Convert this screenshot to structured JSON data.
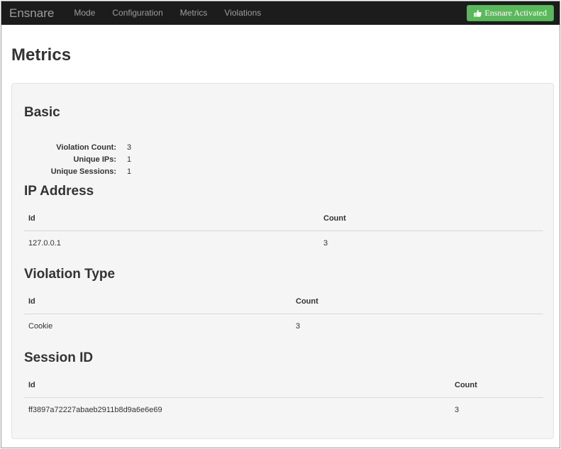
{
  "navbar": {
    "brand": "Ensnare",
    "items": [
      "Mode",
      "Configuration",
      "Metrics",
      "Violations"
    ],
    "status_button": "Ensnare Activated",
    "status_color": "#5cb85c"
  },
  "page": {
    "title": "Metrics"
  },
  "basic": {
    "title": "Basic",
    "rows": [
      {
        "label": "Violation Count:",
        "value": "3"
      },
      {
        "label": "Unique IPs:",
        "value": "1"
      },
      {
        "label": "Unique Sessions:",
        "value": "1"
      }
    ]
  },
  "ip_address": {
    "title": "IP Address",
    "headers": [
      "Id",
      "Count"
    ],
    "rows": [
      [
        "127.0.0.1",
        "3"
      ]
    ]
  },
  "violation_type": {
    "title": "Violation Type",
    "headers": [
      "Id",
      "Count"
    ],
    "rows": [
      [
        "Cookie",
        "3"
      ]
    ]
  },
  "session_id": {
    "title": "Session ID",
    "headers": [
      "Id",
      "Count"
    ],
    "rows": [
      [
        "ff3897a72227abaeb2911b8d9a6e6e69",
        "3"
      ]
    ]
  }
}
